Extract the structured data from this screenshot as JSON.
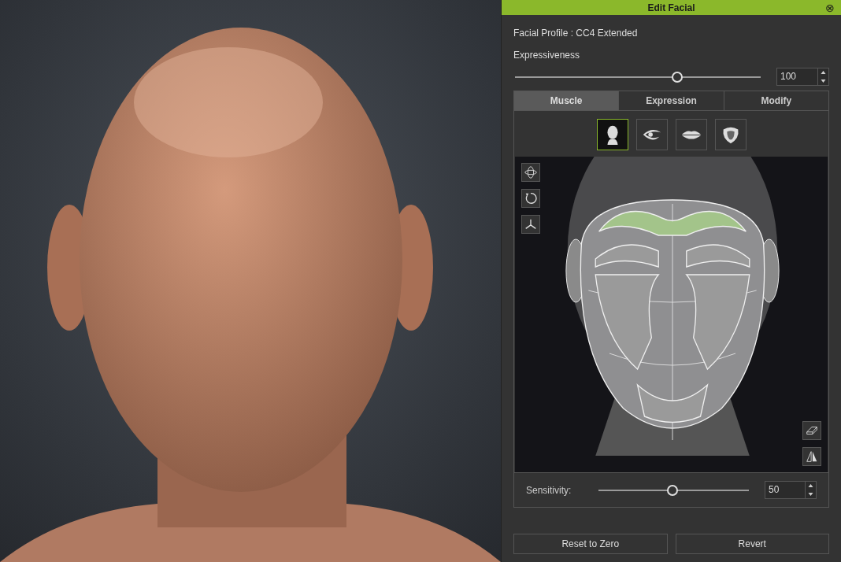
{
  "panel": {
    "title": "Edit Facial",
    "close": "⊗",
    "profile": "Facial Profile : CC4 Extended",
    "expressiveness": {
      "label": "Expressiveness",
      "level": 0.66,
      "value": "100"
    },
    "tabs": [
      {
        "label": "Muscle",
        "selected": true
      },
      {
        "label": "Expression",
        "selected": false
      },
      {
        "label": "Modify",
        "selected": false
      }
    ],
    "categories": [
      {
        "kind": "head",
        "selected": true
      },
      {
        "kind": "eye",
        "selected": false
      },
      {
        "kind": "lips",
        "selected": false
      },
      {
        "kind": "tongue",
        "selected": false
      }
    ],
    "face_map": {
      "regions": [
        {
          "kind": "brow",
          "selected": true
        },
        {
          "kind": "eye",
          "selected": false
        },
        {
          "kind": "cheek",
          "selected": false
        },
        {
          "kind": "jaw",
          "selected": false
        }
      ]
    },
    "sensitivity": {
      "label": "Sensitivity:",
      "level": 0.49,
      "value": "50"
    },
    "buttons": [
      "Reset to Zero",
      "Revert"
    ]
  }
}
